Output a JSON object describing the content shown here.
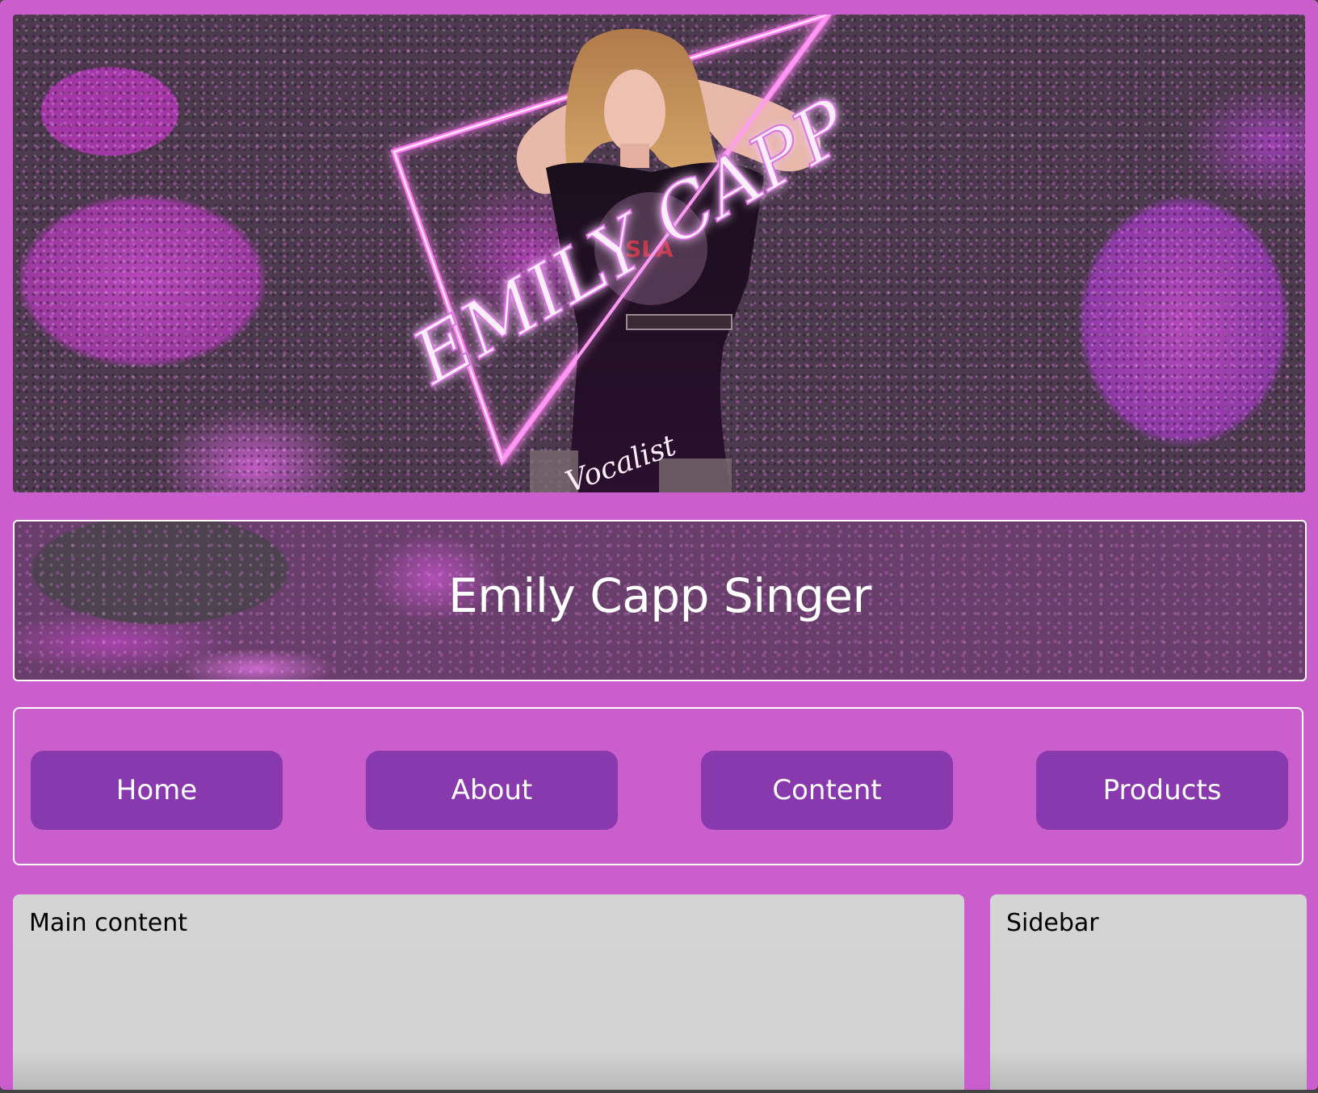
{
  "banner": {
    "logo_text": "EMILY CAPP",
    "logo_subtext": "Vocalist"
  },
  "header": {
    "title": "Emily Capp Singer"
  },
  "nav": {
    "items": [
      {
        "label": "Home"
      },
      {
        "label": "About"
      },
      {
        "label": "Content"
      },
      {
        "label": "Products"
      }
    ]
  },
  "main": {
    "label": "Main content"
  },
  "sidebar": {
    "label": "Sidebar"
  },
  "colors": {
    "page_background": "#cb5ecd",
    "nav_button": "#8839ad",
    "content_box": "#d3d3d3",
    "border": "#ffffff"
  }
}
